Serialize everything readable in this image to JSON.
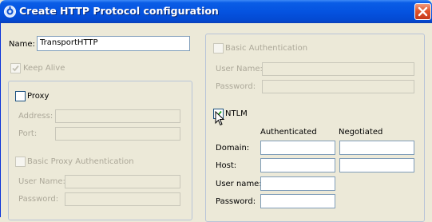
{
  "window": {
    "title": "Create HTTP Protocol configuration",
    "app_icon": "wrench-gear-icon",
    "close_icon": "close-x-icon"
  },
  "form": {
    "name_label": "Name:",
    "name_value": "TransportHTTP",
    "keep_alive_label": "Keep Alive",
    "keep_alive_checked": true,
    "keep_alive_enabled": false
  },
  "proxy": {
    "label": "Proxy",
    "checked": false,
    "address_label": "Address:",
    "address_value": "",
    "port_label": "Port:",
    "port_value": "",
    "basic_auth_label": "Basic Proxy Authentication",
    "user_name_label": "User Name:",
    "user_name_value": "",
    "password_label": "Password:",
    "password_value": ""
  },
  "auth": {
    "basic_label": "Basic Authentication",
    "basic_checked": false,
    "user_name_label": "User Name:",
    "user_name_value": "",
    "password_label": "Password:",
    "password_value": ""
  },
  "ntlm": {
    "label": "NTLM",
    "checked": true,
    "col_authenticated": "Authenticated",
    "col_negotiated": "Negotiated",
    "domain_label": "Domain:",
    "host_label": "Host:",
    "user_name_label": "User name:",
    "password_label": "Password:",
    "domain_authenticated": "",
    "domain_negotiated": "",
    "host_authenticated": "",
    "host_negotiated": "",
    "user_name_value": "",
    "password_value": ""
  },
  "colors": {
    "title_bar": "#0553e0",
    "dialog_bg": "#ece9d8",
    "disabled_text": "#aca899",
    "close_button": "#e1552c"
  }
}
